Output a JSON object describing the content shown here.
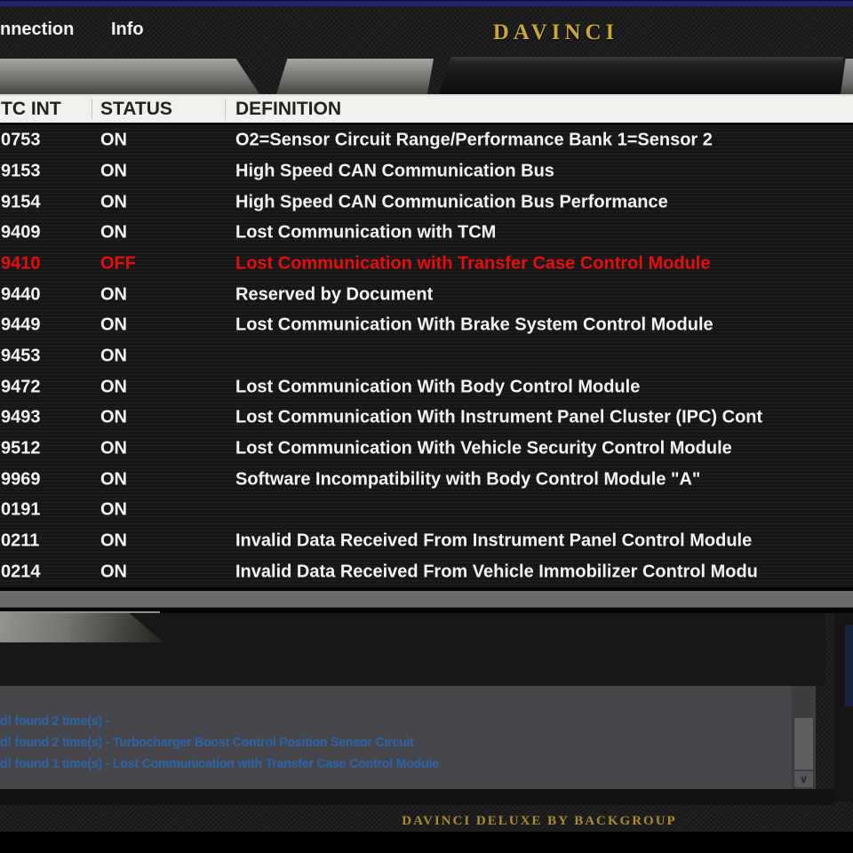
{
  "app": {
    "brand": "DAVINCI",
    "footer": "DAVINCI DELUXE BY BACKGROUP"
  },
  "menu": {
    "items": [
      {
        "label": "nnection"
      },
      {
        "label": "Info"
      }
    ]
  },
  "table": {
    "columns": [
      "TC INT",
      "STATUS",
      "DEFINITION"
    ],
    "rows": [
      {
        "code": "0753",
        "status": "ON",
        "definition": "O2=Sensor Circuit Range/Performance Bank 1=Sensor 2",
        "alert": false
      },
      {
        "code": "9153",
        "status": "ON",
        "definition": "High Speed CAN Communication Bus",
        "alert": false
      },
      {
        "code": "9154",
        "status": "ON",
        "definition": "High Speed CAN Communication Bus Performance",
        "alert": false
      },
      {
        "code": "9409",
        "status": "ON",
        "definition": "Lost Communication with TCM",
        "alert": false
      },
      {
        "code": "9410",
        "status": "OFF",
        "definition": "Lost Communication with Transfer Case Control Module",
        "alert": true
      },
      {
        "code": "9440",
        "status": "ON",
        "definition": "Reserved by Document",
        "alert": false
      },
      {
        "code": "9449",
        "status": "ON",
        "definition": "Lost Communication With Brake System Control Module",
        "alert": false
      },
      {
        "code": "9453",
        "status": "ON",
        "definition": "",
        "alert": false
      },
      {
        "code": "9472",
        "status": "ON",
        "definition": "Lost Communication With Body Control Module",
        "alert": false
      },
      {
        "code": "9493",
        "status": "ON",
        "definition": "Lost Communication With Instrument Panel Cluster (IPC) Cont",
        "alert": false
      },
      {
        "code": "9512",
        "status": "ON",
        "definition": "Lost Communication With Vehicle Security Control Module",
        "alert": false
      },
      {
        "code": "9969",
        "status": "ON",
        "definition": "Software Incompatibility with Body Control Module \"A\"",
        "alert": false
      },
      {
        "code": "0191",
        "status": "ON",
        "definition": "",
        "alert": false
      },
      {
        "code": "0211",
        "status": "ON",
        "definition": "Invalid Data Received From Instrument Panel Control Module",
        "alert": false
      },
      {
        "code": "0214",
        "status": "ON",
        "definition": "Invalid Data Received From Vehicle Immobilizer Control Modu",
        "alert": false
      }
    ]
  },
  "log": {
    "lines": [
      "d! found 2 time(s) -",
      "d! found 2 time(s) - Turbocharger Boost Control Position Sensor Circuit",
      "d! found 1 time(s) - Lost Communication with Transfer Case Control Module"
    ]
  },
  "icons": {
    "scroll_down_icon": "∨"
  },
  "colors": {
    "top_accent_blue": "#23246f",
    "brand_gold": "#c9a638",
    "footer_gold": "#a98c32",
    "alert_red": "#e60d0d",
    "status_on_white": "#f3f3f3",
    "log_blue": "#2a63a8",
    "header_bg": "#f1f0ea"
  }
}
